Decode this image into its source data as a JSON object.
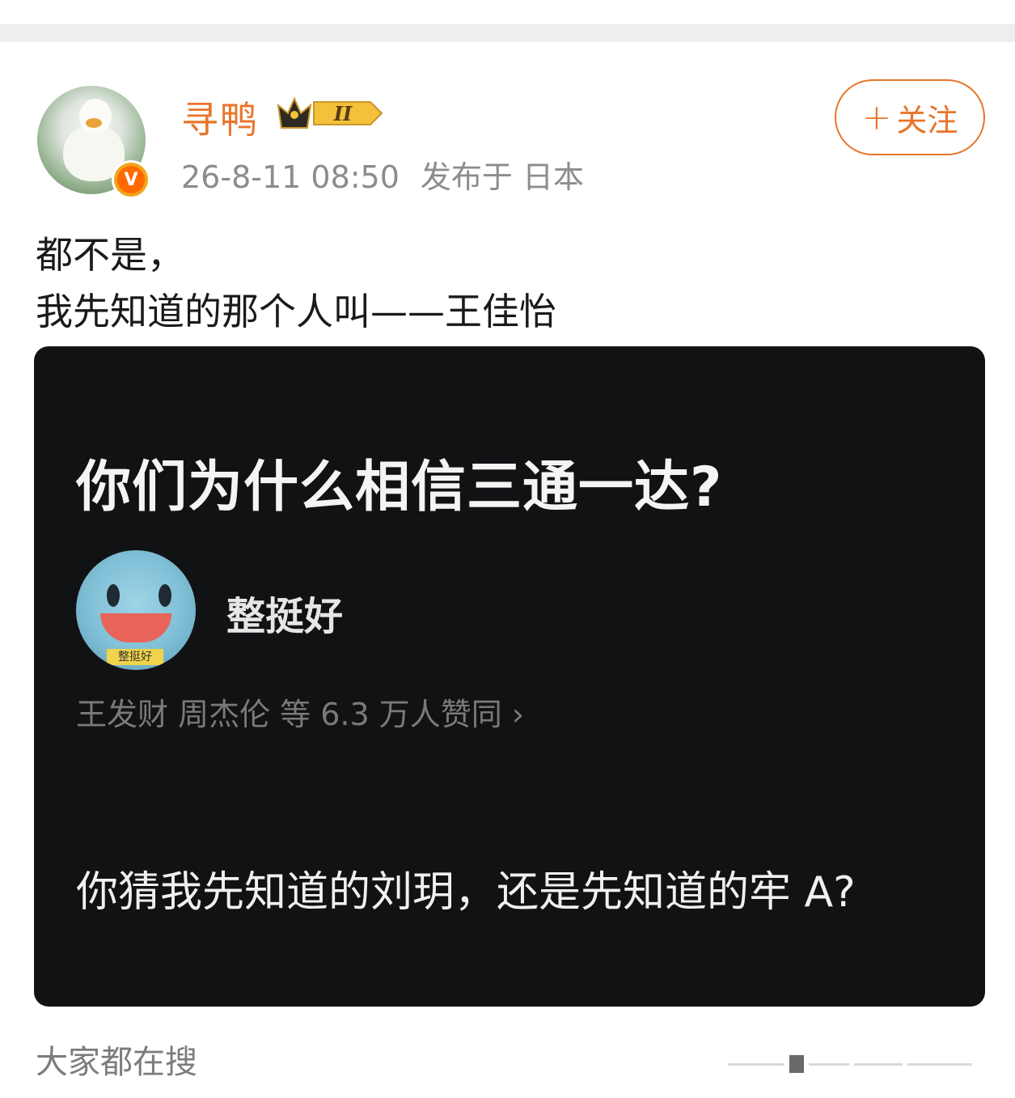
{
  "header": {
    "username": "寻鸭",
    "rank_badge": "II",
    "timestamp": "26-8-11 08:50",
    "location": "发布于 日本",
    "verify_icon": "V",
    "follow_label": "关注",
    "follow_icon": "plus-icon"
  },
  "post": {
    "lines": [
      "都不是，",
      "我先知道的那个人叫——王佳怡"
    ]
  },
  "image": {
    "title": "你们为什么相信三通一达?",
    "author": "整挺好",
    "avatar_tag": "整挺好",
    "likes": "王发财 周杰伦 等 6.3 万人赞同 ›",
    "answer": "你猜我先知道的刘玥，还是先知道的牢 A?"
  },
  "search": {
    "heading": "大家都在搜"
  },
  "colors": {
    "accent": "#e8742a",
    "image_bg": "#111214",
    "meta_text": "#8c8c8c"
  }
}
